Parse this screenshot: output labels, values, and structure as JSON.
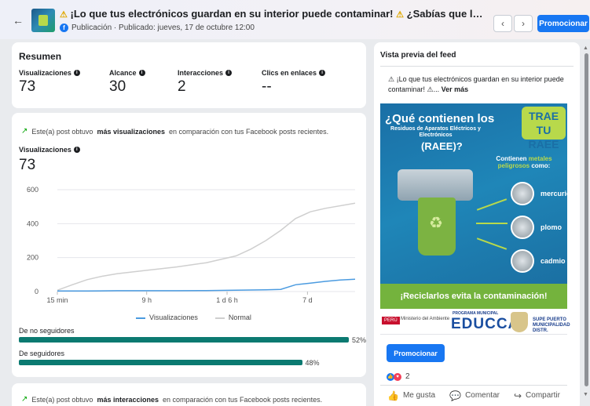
{
  "header": {
    "back_icon": "arrow-left-icon",
    "title_warning_1": "⚠",
    "title_text": "¡Lo que tus electrónicos guardan en su interior puede contaminar!",
    "title_warning_2": "⚠",
    "title_text_2": "¿Sabías que los Residuos de Aparatos Eléct...",
    "subtitle": "Publicación · Publicado: jueves, 17 de octubre 12:00",
    "prev_label": "‹",
    "next_label": "›",
    "promote_label": "Promocionar"
  },
  "summary": {
    "title": "Resumen",
    "metrics": [
      {
        "label": "Visualizaciones",
        "value": "73"
      },
      {
        "label": "Alcance",
        "value": "30"
      },
      {
        "label": "Interacciones",
        "value": "2"
      },
      {
        "label": "Clics en enlaces",
        "value": "--"
      }
    ]
  },
  "views": {
    "trend_prefix": "Este(a) post obtuvo",
    "trend_bold": "más visualizaciones",
    "trend_suffix": "en comparación con tus Facebook posts recientes.",
    "metric_label": "Visualizaciones",
    "metric_value": "73",
    "non_followers_label": "De no seguidores",
    "non_followers_pct_label": "52%",
    "non_followers_pct": 52,
    "followers_label": "De seguidores",
    "followers_pct_label": "48%",
    "followers_pct": 48
  },
  "chart_data": {
    "type": "line",
    "x_ticks": [
      "15 min",
      "9 h",
      "1 d 6 h",
      "7 d"
    ],
    "yticks": [
      "0",
      "200",
      "400",
      "600"
    ],
    "ylim": [
      0,
      600
    ],
    "grid": true,
    "legend_position": "bottom-center",
    "series": [
      {
        "name": "Visualizaciones",
        "color": "#4b9be0",
        "x": [
          0,
          0.1,
          0.2,
          0.3,
          0.4,
          0.5,
          0.6,
          0.7,
          0.75,
          0.8,
          0.85,
          0.9,
          0.95,
          1.0
        ],
        "values": [
          3,
          3,
          5,
          5,
          5,
          6,
          8,
          10,
          13,
          40,
          50,
          60,
          68,
          73
        ]
      },
      {
        "name": "Normal",
        "color": "#cfcfcf",
        "x": [
          0,
          0.05,
          0.1,
          0.15,
          0.2,
          0.3,
          0.4,
          0.5,
          0.6,
          0.65,
          0.7,
          0.75,
          0.8,
          0.85,
          0.9,
          1.0
        ],
        "values": [
          8,
          40,
          70,
          90,
          105,
          125,
          145,
          170,
          210,
          250,
          300,
          360,
          430,
          470,
          490,
          520
        ]
      }
    ]
  },
  "interactions": {
    "trend_prefix": "Este(a) post obtuvo",
    "trend_bold": "más interacciones",
    "trend_suffix": "en comparación con tus Facebook posts recientes."
  },
  "preview": {
    "title": "Vista previa del feed",
    "caption": "⚠ ¡Lo que tus electrónicos guardan en su interior puede contaminar! ⚠...",
    "see_more": "Ver más",
    "poster": {
      "title": "¿Qué contienen los",
      "subtitle": "Residuos de Aparatos Eléctricos y Electrónicos",
      "acronym": "(RAEE)?",
      "logo_text": "TRAE TU RAEE",
      "metals_prefix": "Contienen",
      "metals_highlight": "metales peligrosos",
      "metals_suffix": "como:",
      "metals": [
        "mercurio",
        "plomo",
        "cadmio"
      ],
      "band": "¡Reciclarlos evita la contaminación!"
    },
    "logos": {
      "peru": "PERÚ",
      "ministry": "Ministerio del Ambiente",
      "program": "PROGRAMA MUNICIPAL",
      "educca": "EDUCCA",
      "supe": "SUPE PUERTO MUNICIPALIDAD DISTR."
    },
    "promote_label": "Promocionar",
    "reaction_count": "2",
    "like_label": "Me gusta",
    "comment_label": "Comentar",
    "share_label": "Compartir"
  }
}
